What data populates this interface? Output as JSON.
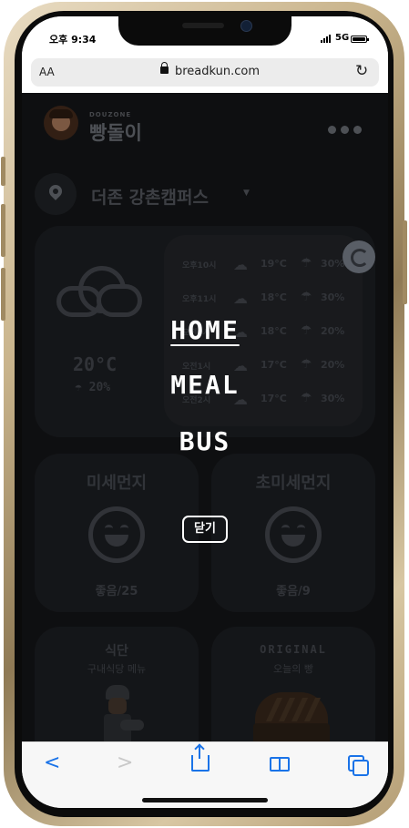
{
  "status_bar": {
    "time": "오후 9:34",
    "network": "5G"
  },
  "browser": {
    "text_size": "AA",
    "url": "breadkun.com"
  },
  "header": {
    "brand_small": "DOUZONE",
    "brand": "빵돌이"
  },
  "location": {
    "campus": "더존 강촌캠퍼스"
  },
  "weather": {
    "current_temp": "20°C",
    "current_rain": "20%",
    "forecast": [
      {
        "time": "오후10시",
        "temp": "19°C",
        "rain": "30%"
      },
      {
        "time": "오후11시",
        "temp": "18°C",
        "rain": "30%"
      },
      {
        "time": "오전0시",
        "temp": "18°C",
        "rain": "20%"
      },
      {
        "time": "오전1시",
        "temp": "17°C",
        "rain": "20%"
      },
      {
        "time": "오전2시",
        "temp": "17°C",
        "rain": "30%"
      }
    ]
  },
  "dust": {
    "fine": {
      "title": "미세먼지",
      "value": "좋음/25"
    },
    "ultrafine": {
      "title": "초미세먼지",
      "value": "좋음/9"
    }
  },
  "meal_card": {
    "title": "식단",
    "subtitle": "구내식당 메뉴"
  },
  "bread_card": {
    "title": "ORIGINAL",
    "subtitle": "오늘의 빵"
  },
  "nav_menu": {
    "home": "HOME",
    "meal": "MEAL",
    "bus": "BUS",
    "close": "닫기"
  },
  "icons": [
    "location-pin-icon",
    "cloud-icon",
    "umbrella-icon",
    "refresh-icon",
    "smile-icon",
    "back-icon",
    "forward-icon",
    "share-icon",
    "bookmarks-icon",
    "tabs-icon"
  ]
}
